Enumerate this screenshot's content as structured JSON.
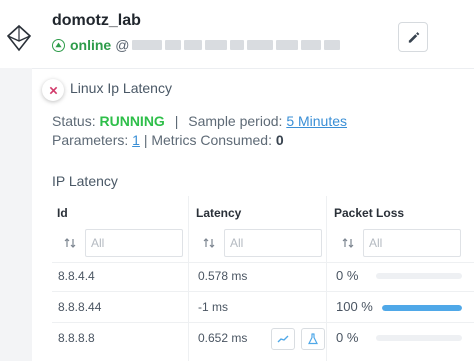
{
  "agent": {
    "name": "domotz_lab",
    "status": "online",
    "at": "@"
  },
  "icons": {
    "logo": "domotz-diamond-logo-icon",
    "online": "arrow-up-circle-icon",
    "edit": "pencil-icon",
    "close": "close-icon",
    "sort": "sort-arrows-icon",
    "graph": "line-chart-icon",
    "history": "flask-icon"
  },
  "panel": {
    "title": "Linux Ip Latency",
    "status_label": "Status:",
    "status_value": "RUNNING",
    "separator": "|",
    "sample_period_label": "Sample period:",
    "sample_period_value": "5 Minutes",
    "parameters_label": "Parameters:",
    "parameters_value": "1",
    "metrics_consumed_label": "Metrics Consumed:",
    "metrics_consumed_value": "0"
  },
  "table": {
    "title": "IP Latency",
    "columns": [
      "Id",
      "Latency",
      "Packet Loss"
    ],
    "filter_placeholder": "All",
    "rows": [
      {
        "id": "8.8.4.4",
        "latency": "0.578 ms",
        "packet_loss": "0 %",
        "loss_fraction": 0.0
      },
      {
        "id": "8.8.8.44",
        "latency": "-1 ms",
        "packet_loss": "100 %",
        "loss_fraction": 1.0
      },
      {
        "id": "8.8.8.8",
        "latency": "0.652 ms",
        "packet_loss": "0 %",
        "loss_fraction": 0.0
      }
    ]
  },
  "colors": {
    "online": "#2e9c4a",
    "running": "#2fbf4a",
    "link": "#3a8fd6",
    "bar_fill": "#4fa8e8",
    "close_x": "#d23a6a"
  }
}
